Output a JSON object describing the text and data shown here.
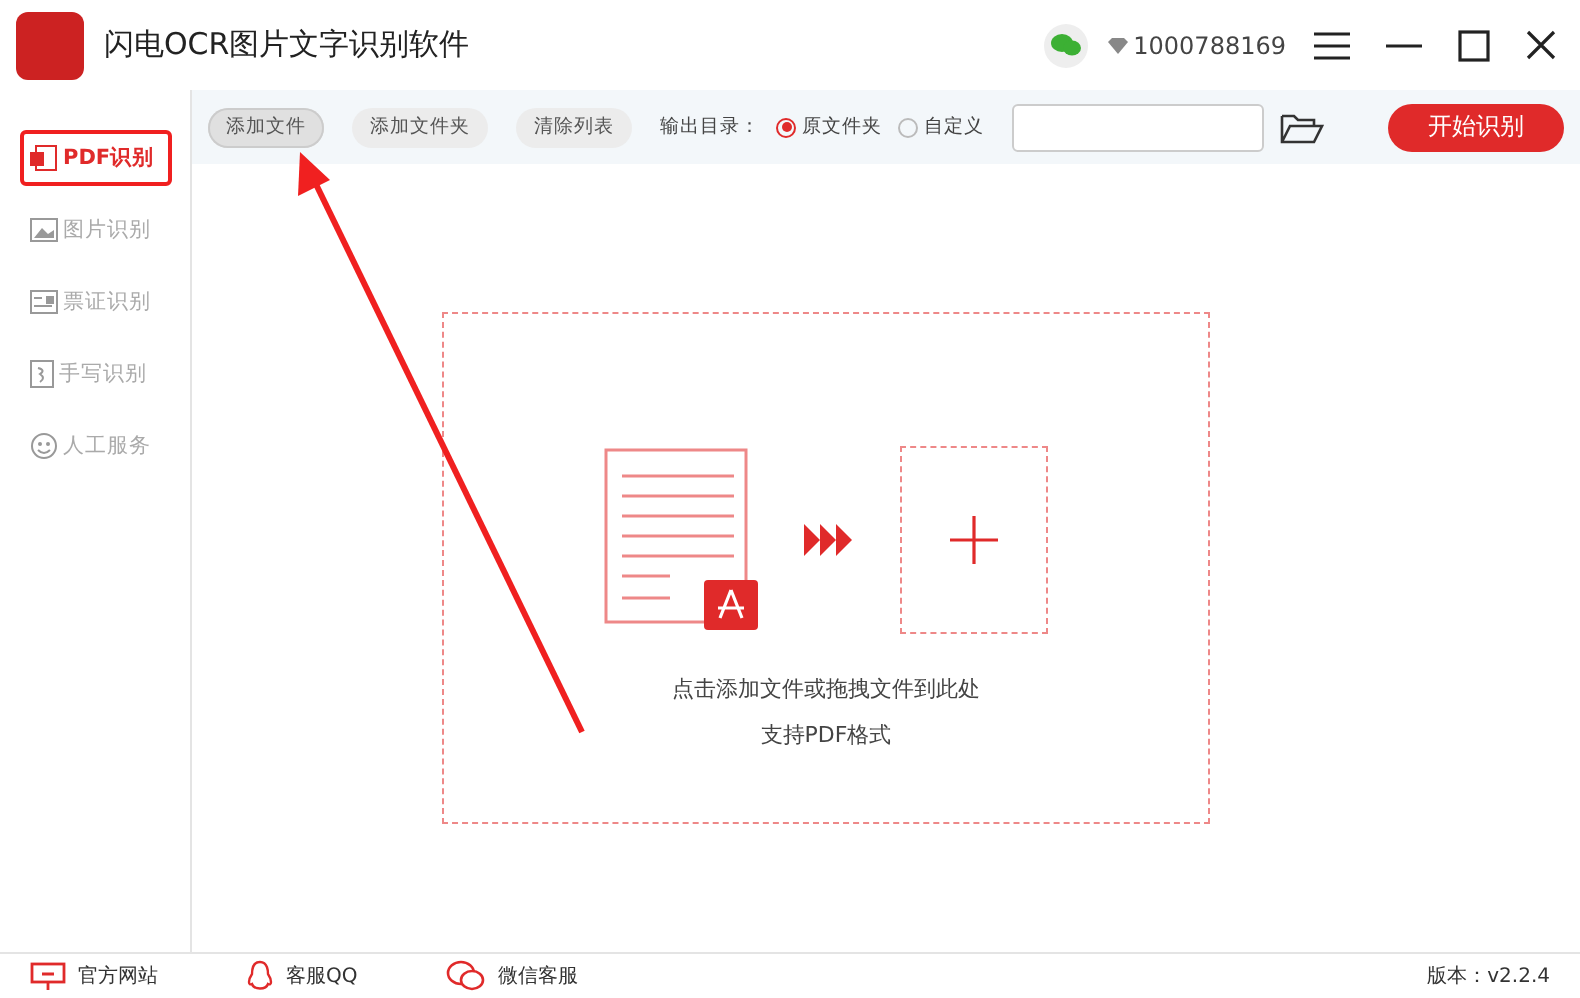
{
  "window": {
    "title": "闪电OCR图片文字识别软件",
    "account": "1000788169"
  },
  "toolbar": {
    "buttons": [
      {
        "label": "添加文件",
        "selected": true
      },
      {
        "label": "添加文件夹",
        "selected": false
      },
      {
        "label": "清除列表",
        "selected": false
      }
    ],
    "output_label": "输出目录：",
    "output_options": [
      {
        "label": "原文件夹",
        "selected": true
      },
      {
        "label": "自定义",
        "selected": false
      }
    ],
    "start_button": "开始识别"
  },
  "sidebar": {
    "items": [
      {
        "label": "PDF识别",
        "kind": "pdf",
        "selected": true,
        "highlighted": true
      },
      {
        "label": "图片识别",
        "kind": "image",
        "selected": false,
        "highlighted": false
      },
      {
        "label": "票证识别",
        "kind": "card",
        "selected": false,
        "highlighted": false
      },
      {
        "label": "手写识别",
        "kind": "hand",
        "selected": false,
        "highlighted": false
      },
      {
        "label": "人工服务",
        "kind": "smile",
        "selected": false,
        "highlighted": false
      }
    ]
  },
  "drop_zone": {
    "hint": "点击添加文件或拖拽文件到此处",
    "formats": "支持PDF格式"
  },
  "annotation_arrow": true,
  "status_bar": {
    "links": [
      {
        "label": "官方网站",
        "kind": "monitor"
      },
      {
        "label": "客服QQ",
        "kind": "qq"
      },
      {
        "label": "微信客服",
        "kind": "wechat"
      }
    ],
    "version": "版本：v2.2.4"
  }
}
